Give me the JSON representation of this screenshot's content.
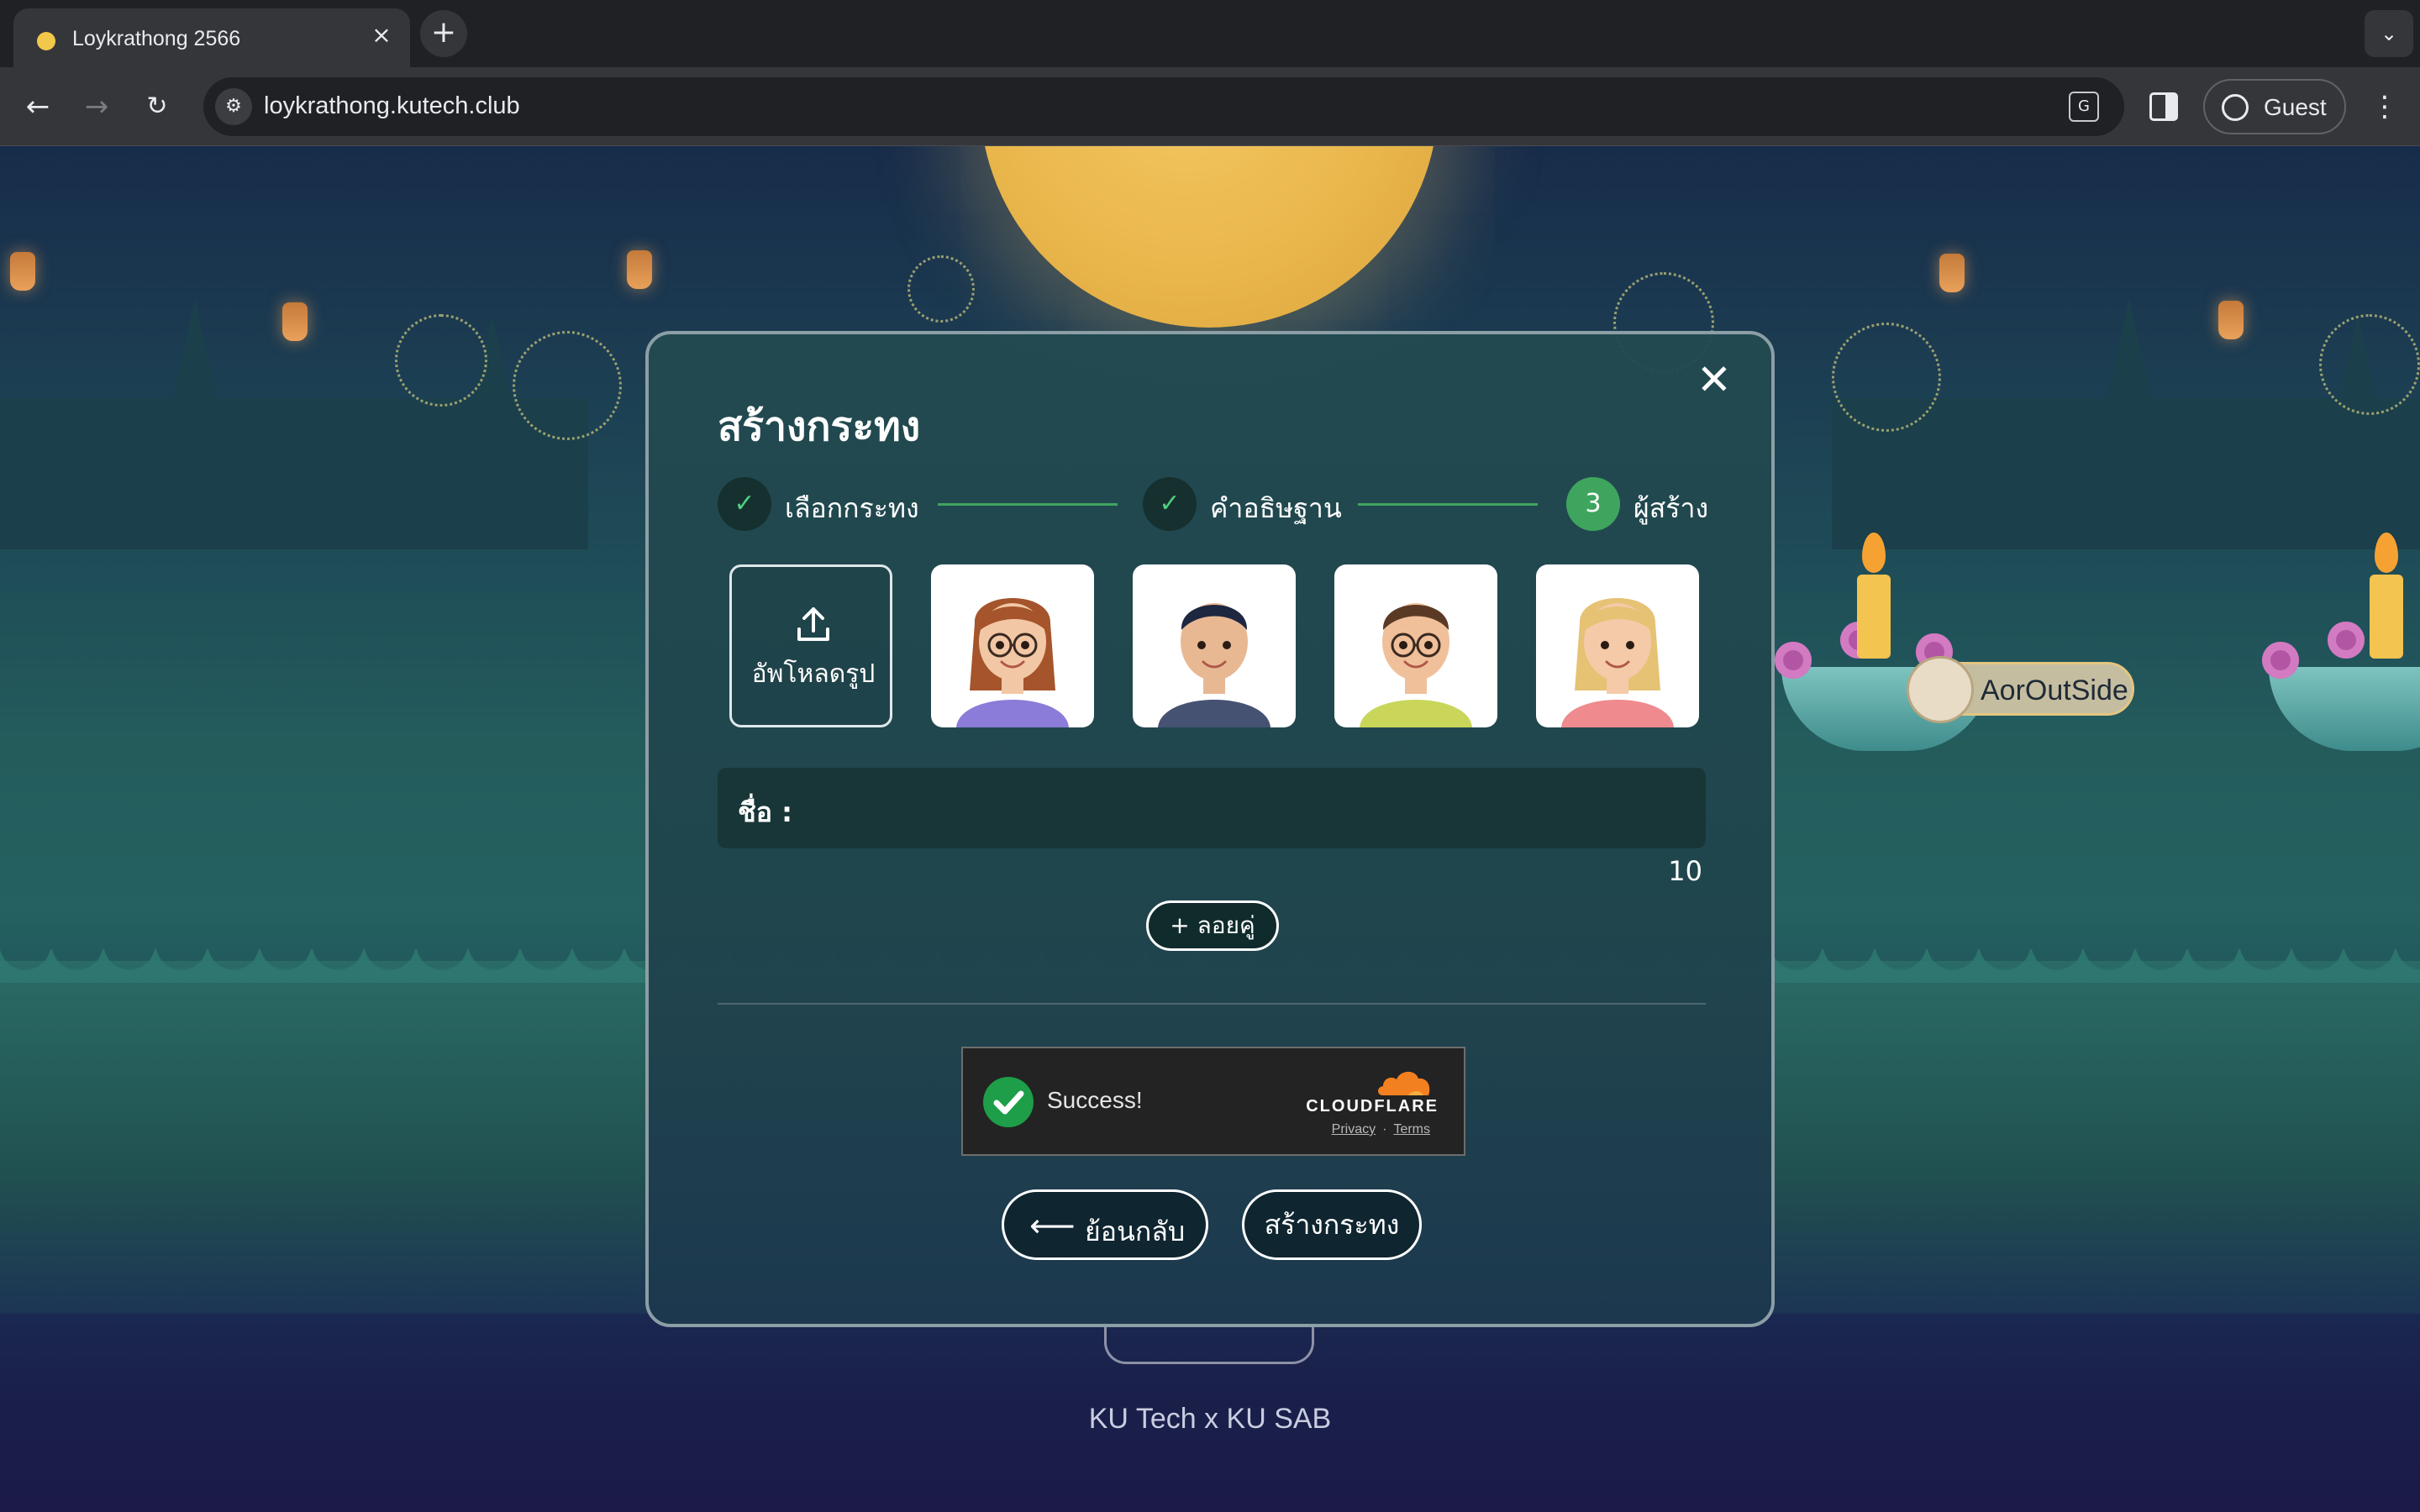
{
  "browser": {
    "tab_title": "Loykrathong 2566",
    "url": "loykrathong.kutech.club",
    "profile_label": "Guest"
  },
  "modal": {
    "title": "สร้างกระทง",
    "steps": [
      {
        "label": "เลือกกระทง",
        "state": "done",
        "badge": "✓"
      },
      {
        "label": "คำอธิษฐาน",
        "state": "done",
        "badge": "✓"
      },
      {
        "label": "ผู้สร้าง",
        "state": "active",
        "badge": "3"
      }
    ],
    "upload_label": "อัพโหลดรูป",
    "avatars": [
      {
        "name": "avatar-girl-glasses",
        "hair": "#a5542b",
        "skin": "#f2c7a5",
        "shirt": "#8a7cd8"
      },
      {
        "name": "avatar-boy-hoodie",
        "hair": "#1d2740",
        "skin": "#e8b893",
        "shirt": "#465272"
      },
      {
        "name": "avatar-boy-glasses",
        "hair": "#5b3a25",
        "skin": "#f0c09a",
        "shirt": "#c9d65a"
      },
      {
        "name": "avatar-girl-blonde",
        "hair": "#e6c274",
        "skin": "#f4caa8",
        "shirt": "#ef8a8e"
      }
    ],
    "name_label": "ชื่อ :",
    "name_value": "",
    "char_count": "10",
    "pair_button": "+ ลอยคู่",
    "captcha": {
      "status": "Success!",
      "brand": "CLOUDFLARE",
      "privacy": "Privacy",
      "separator": "·",
      "terms": "Terms"
    },
    "back_button": "ย้อนกลับ",
    "create_button": "สร้างกระทง"
  },
  "scene": {
    "floating_name_tag": "AorOutSide",
    "footer_credit": "KU Tech x KU SAB"
  },
  "colors": {
    "accent_green": "#3fa55e",
    "captcha_success": "#1e9e48",
    "cloudflare_orange": "#f38020",
    "moon": "#e8b54a"
  }
}
